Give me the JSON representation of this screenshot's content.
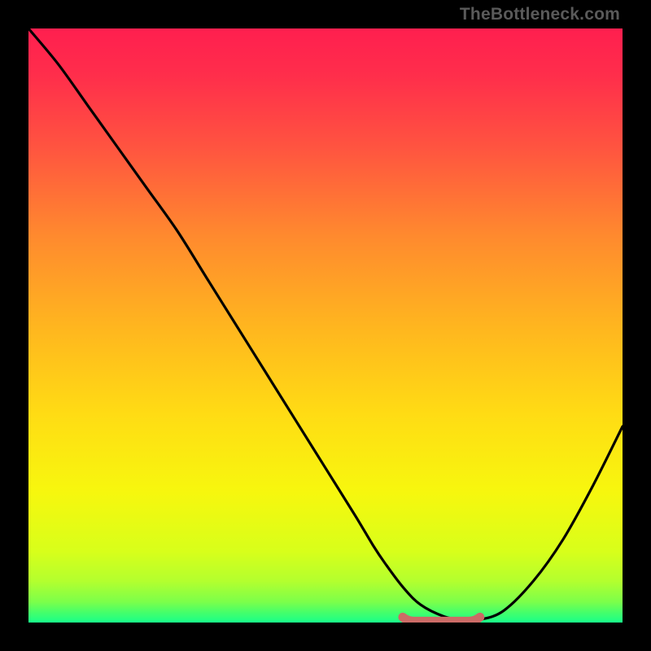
{
  "watermark": "TheBottleneck.com",
  "colors": {
    "gradient_stops": [
      {
        "offset": 0.0,
        "color": "#ff1f4f"
      },
      {
        "offset": 0.08,
        "color": "#ff2e4b"
      },
      {
        "offset": 0.2,
        "color": "#ff5440"
      },
      {
        "offset": 0.35,
        "color": "#ff8a2e"
      },
      {
        "offset": 0.5,
        "color": "#ffb51f"
      },
      {
        "offset": 0.65,
        "color": "#ffdc14"
      },
      {
        "offset": 0.78,
        "color": "#f7f70e"
      },
      {
        "offset": 0.88,
        "color": "#d8ff1a"
      },
      {
        "offset": 0.93,
        "color": "#b4ff2e"
      },
      {
        "offset": 0.965,
        "color": "#7cff4a"
      },
      {
        "offset": 0.985,
        "color": "#40ff6e"
      },
      {
        "offset": 1.0,
        "color": "#18ff8a"
      }
    ],
    "curve": "#000000",
    "annotation": "#cc6b66",
    "background": "#000000"
  },
  "chart_data": {
    "type": "line",
    "title": "",
    "xlabel": "",
    "ylabel": "",
    "xlim": [
      0,
      100
    ],
    "ylim": [
      0,
      100
    ],
    "grid": false,
    "legend": false,
    "series": [
      {
        "name": "bottleneck-curve",
        "x": [
          0,
          5,
          10,
          15,
          20,
          25,
          30,
          35,
          40,
          45,
          50,
          55,
          58,
          60,
          63,
          66,
          70,
          73,
          76,
          80,
          85,
          90,
          95,
          100
        ],
        "y": [
          100,
          94,
          87,
          80,
          73,
          66,
          58,
          50,
          42,
          34,
          26,
          18,
          13,
          10,
          6,
          3,
          1,
          0.5,
          0.5,
          2,
          7,
          14,
          23,
          33
        ]
      }
    ],
    "annotation": {
      "name": "optimal-range-marker",
      "x_range": [
        63,
        76
      ],
      "y": 0.5
    }
  }
}
